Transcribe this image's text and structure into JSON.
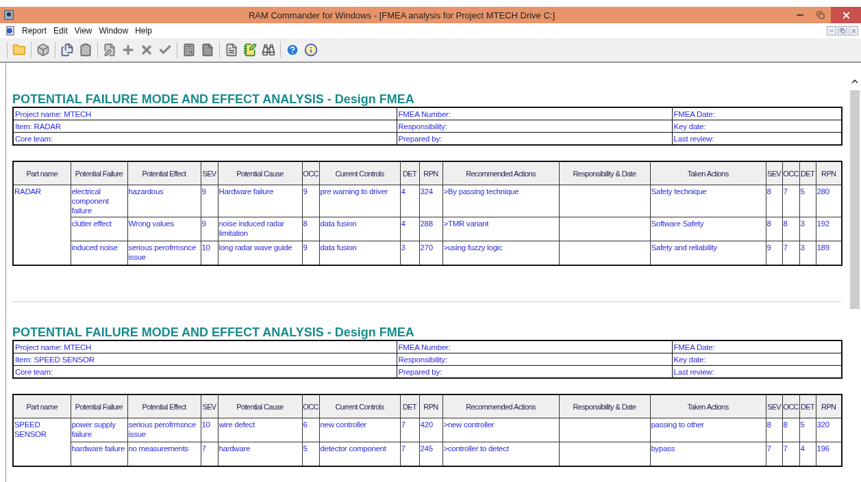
{
  "window": {
    "title": "RAM Commander for Windows - [FMEA analysis for Project MTECH Drive C:]"
  },
  "menu": [
    {
      "label": "Report"
    },
    {
      "label": "Edit"
    },
    {
      "label": "View"
    },
    {
      "label": "Window"
    },
    {
      "label": "Help"
    }
  ],
  "reports": [
    {
      "title": "POTENTIAL FAILURE MODE AND EFFECT ANALYSIS - Design FMEA",
      "info": [
        [
          "Project name: MTECH",
          "FMEA Number:",
          "FMEA Date:"
        ],
        [
          "Item: RADAR",
          "Responsibility:",
          "Key date:"
        ],
        [
          "Core team:",
          "Prepared by:",
          "Last review:"
        ]
      ],
      "columns": [
        "Part name",
        "Potential Failure",
        "Potential Effect",
        "SEV",
        "Potential Cause",
        "OCC",
        "Current Controls",
        "DET",
        "RPN",
        "Recommended Actions",
        "Responsibility & Date",
        "Taken Actions",
        "SEV",
        "OCC",
        "DET",
        "RPN"
      ],
      "rows": [
        {
          "part": "RADAR",
          "failures": [
            {
              "failure": "electrical component failure",
              "effect": "hazardous",
              "sev": "9",
              "cause": "Hardware failure",
              "occ": "9",
              "controls": "pre warning to driver",
              "det": "4",
              "rpn": "324",
              "recommended": ">By passing technique",
              "taken": "Safety technique",
              "new_sev": "8",
              "new_occ": "7",
              "new_det": "5",
              "new_rpn": "280"
            },
            {
              "failure": "clutter effect",
              "effect": "Wrong values",
              "sev": "9",
              "cause": "noise induced radar limitation",
              "occ": "8",
              "controls": "data fusion",
              "det": "4",
              "rpn": "288",
              "recommended": ">TMR variant",
              "taken": "Software Safety",
              "new_sev": "8",
              "new_occ": "8",
              "new_det": "3",
              "new_rpn": "192"
            },
            {
              "failure": "induced noise",
              "effect": "serious perofrmsnce issue",
              "sev": "10",
              "cause": "long radar wave guide",
              "occ": "9",
              "controls": "data fusion",
              "det": "3",
              "rpn": "270",
              "recommended": ">using fuzzy logic",
              "taken": "Safety and reliability",
              "new_sev": "9",
              "new_occ": "7",
              "new_det": "3",
              "new_rpn": "189"
            }
          ]
        }
      ]
    },
    {
      "title": "POTENTIAL FAILURE MODE AND EFFECT ANALYSIS - Design FMEA",
      "info": [
        [
          "Project name: MTECH",
          "FMEA Number:",
          "FMEA Date:"
        ],
        [
          "Item: SPEED SENSOR",
          "Responsibility:",
          "Key date:"
        ],
        [
          "Core team:",
          "Prepared by:",
          "Last review:"
        ]
      ],
      "columns": [
        "Part name",
        "Potential Failure",
        "Potential Effect",
        "SEV",
        "Potential Cause",
        "OCC",
        "Current Controls",
        "DET",
        "RPN",
        "Recommended Actions",
        "Responsibility & Date",
        "Taken Actions",
        "SEV",
        "OCC",
        "DET",
        "RPN"
      ],
      "rows": [
        {
          "part": "SPEED SENSOR",
          "failures": [
            {
              "failure": "power supply failure",
              "effect": "serious perofrmsnce issue",
              "sev": "10",
              "cause": "wire defect",
              "occ": "6",
              "controls": "new controller",
              "det": "7",
              "rpn": "420",
              "recommended": ">new controller",
              "taken": "passing to other",
              "new_sev": "8",
              "new_occ": "8",
              "new_det": "5",
              "new_rpn": "320"
            },
            {
              "failure": "hardware failure",
              "effect": "no measurements",
              "sev": "7",
              "cause": "hardware",
              "occ": "5",
              "controls": "detector component",
              "det": "7",
              "rpn": "245",
              "recommended": ">controller to detect",
              "taken": "bypass",
              "new_sev": "7",
              "new_occ": "7",
              "new_det": "4",
              "new_rpn": "196"
            }
          ]
        }
      ]
    }
  ]
}
